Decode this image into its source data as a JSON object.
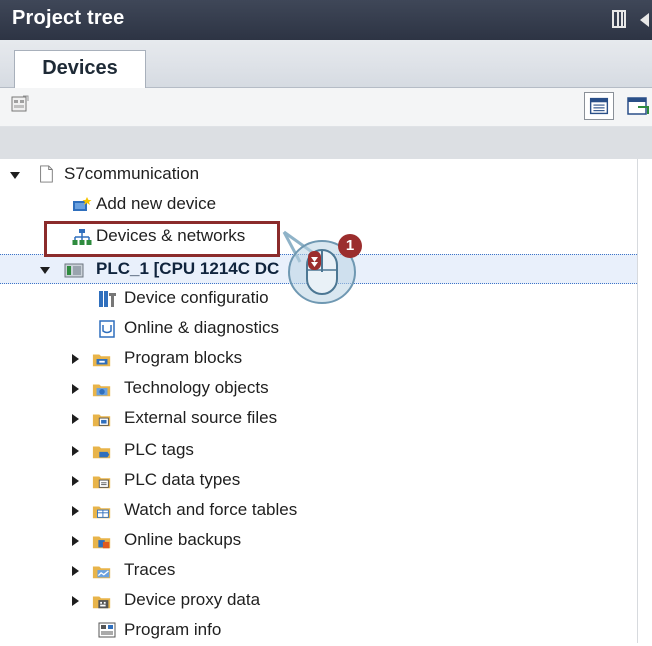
{
  "panel": {
    "title": "Project tree"
  },
  "tabs": [
    {
      "label": "Devices"
    }
  ],
  "tree": {
    "root": "S7communication",
    "items": [
      {
        "label": "Add new device"
      },
      {
        "label": "Devices & networks"
      },
      {
        "label": "PLC_1 [CPU 1214C DC"
      },
      {
        "label": "Device configuratio"
      },
      {
        "label": "Online & diagnostics"
      },
      {
        "label": "Program blocks"
      },
      {
        "label": "Technology objects"
      },
      {
        "label": "External source files"
      },
      {
        "label": "PLC tags"
      },
      {
        "label": "PLC data types"
      },
      {
        "label": "Watch and force tables"
      },
      {
        "label": "Online backups"
      },
      {
        "label": "Traces"
      },
      {
        "label": "Device proxy data"
      },
      {
        "label": "Program info"
      }
    ]
  },
  "callout": {
    "step": "1"
  },
  "colors": {
    "title_bg": "#363d4d",
    "highlight_border": "#8b2b2b",
    "selection_bg": "#e9f0fb",
    "badge_bg": "#9b2d2d"
  }
}
